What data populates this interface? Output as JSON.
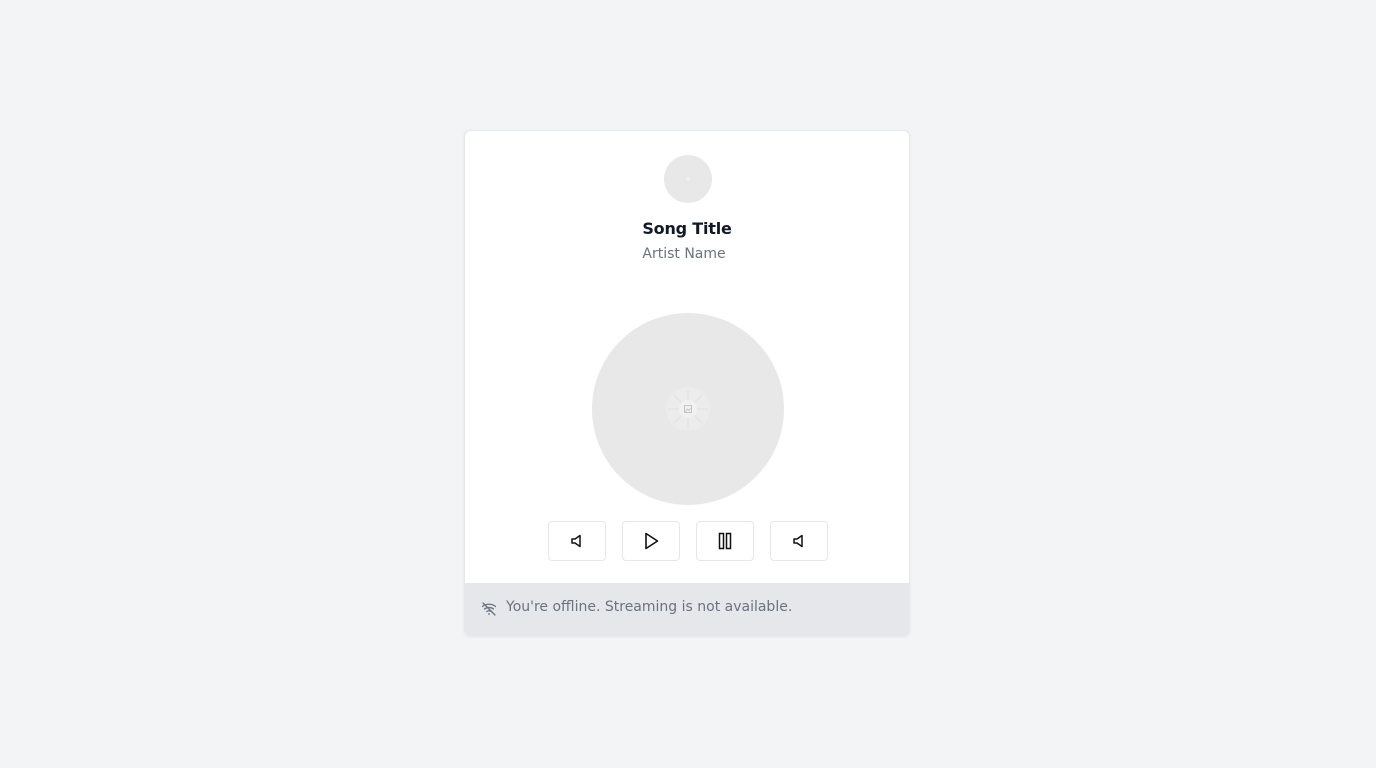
{
  "player": {
    "song_title": "Song Title",
    "artist_name": "Artist Name",
    "icons": {
      "avatar": "album-art-placeholder-icon",
      "disc_center": "image-placeholder-icon"
    },
    "controls": [
      {
        "name": "previous-button",
        "icon": "speaker-icon"
      },
      {
        "name": "play-button",
        "icon": "play-icon"
      },
      {
        "name": "pause-button",
        "icon": "pause-icon"
      },
      {
        "name": "next-button",
        "icon": "speaker-icon"
      }
    ]
  },
  "status": {
    "icon": "wifi-off-icon",
    "message": "You're offline. Streaming is not available.",
    "background": "#e5e7eb",
    "text_color": "#6b7280"
  },
  "colors": {
    "page_background": "#f3f4f6",
    "card_background": "#ffffff",
    "placeholder": "#e8e8e8",
    "title_color": "#111827"
  }
}
